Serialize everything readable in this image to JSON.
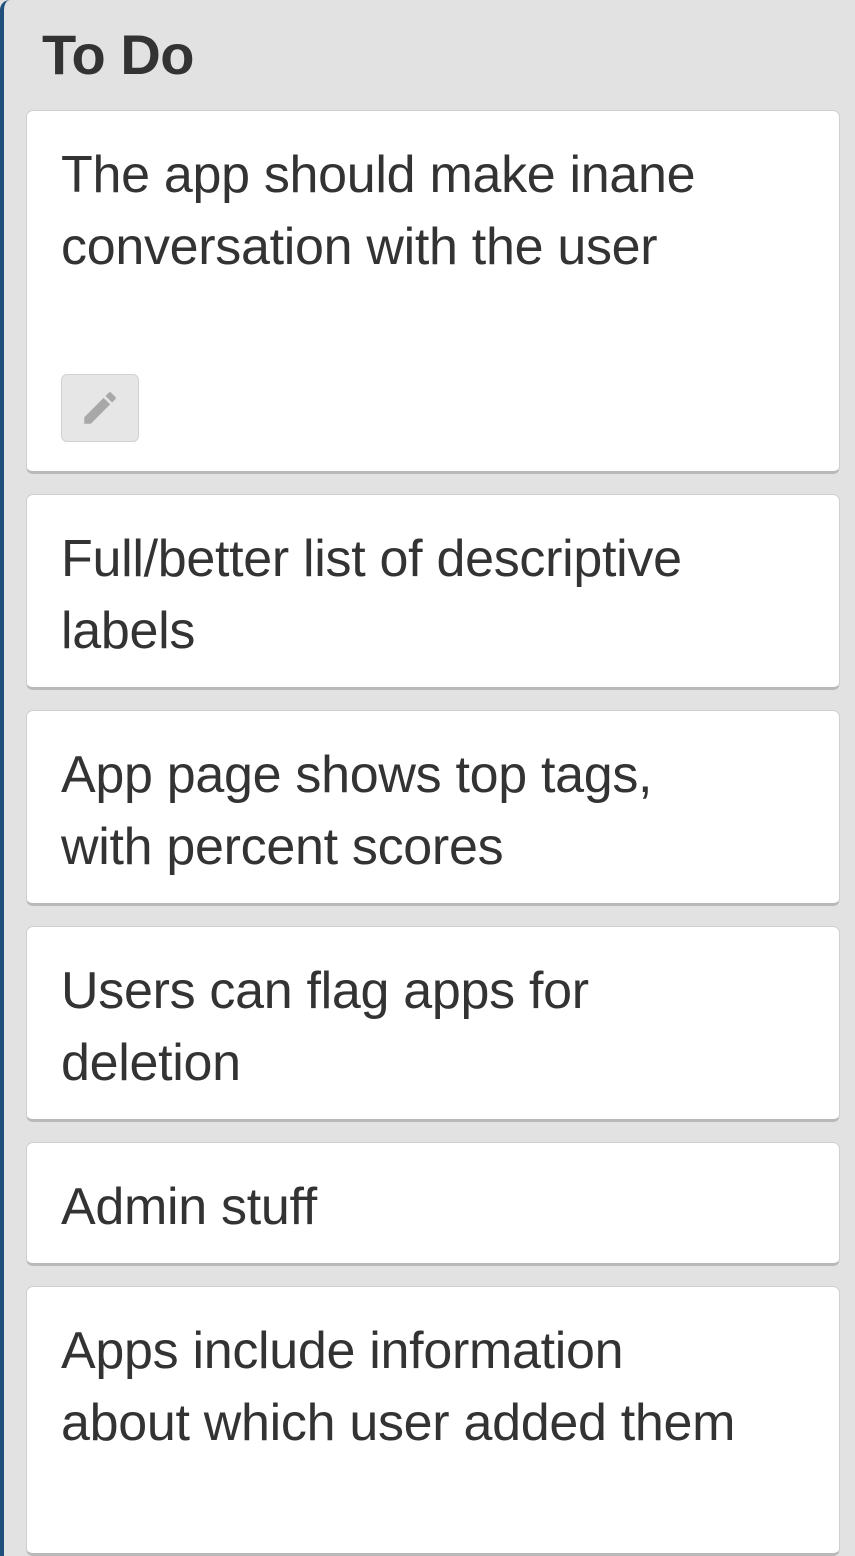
{
  "list": {
    "title": "To Do",
    "cards": [
      {
        "text": "The app should make inane conversation with the user",
        "badge_icon": "pencil-icon"
      },
      {
        "text": "Full/better list of descriptive labels"
      },
      {
        "text": "App page shows top tags, with percent scores"
      },
      {
        "text": "Users can flag apps for deletion"
      },
      {
        "text": "Admin stuff"
      },
      {
        "text": "Apps include information about which user added them"
      }
    ]
  },
  "colors": {
    "list_background": "#e2e2e2",
    "card_background": "#ffffff",
    "text": "#333333",
    "left_edge": "#1f4f7a"
  }
}
